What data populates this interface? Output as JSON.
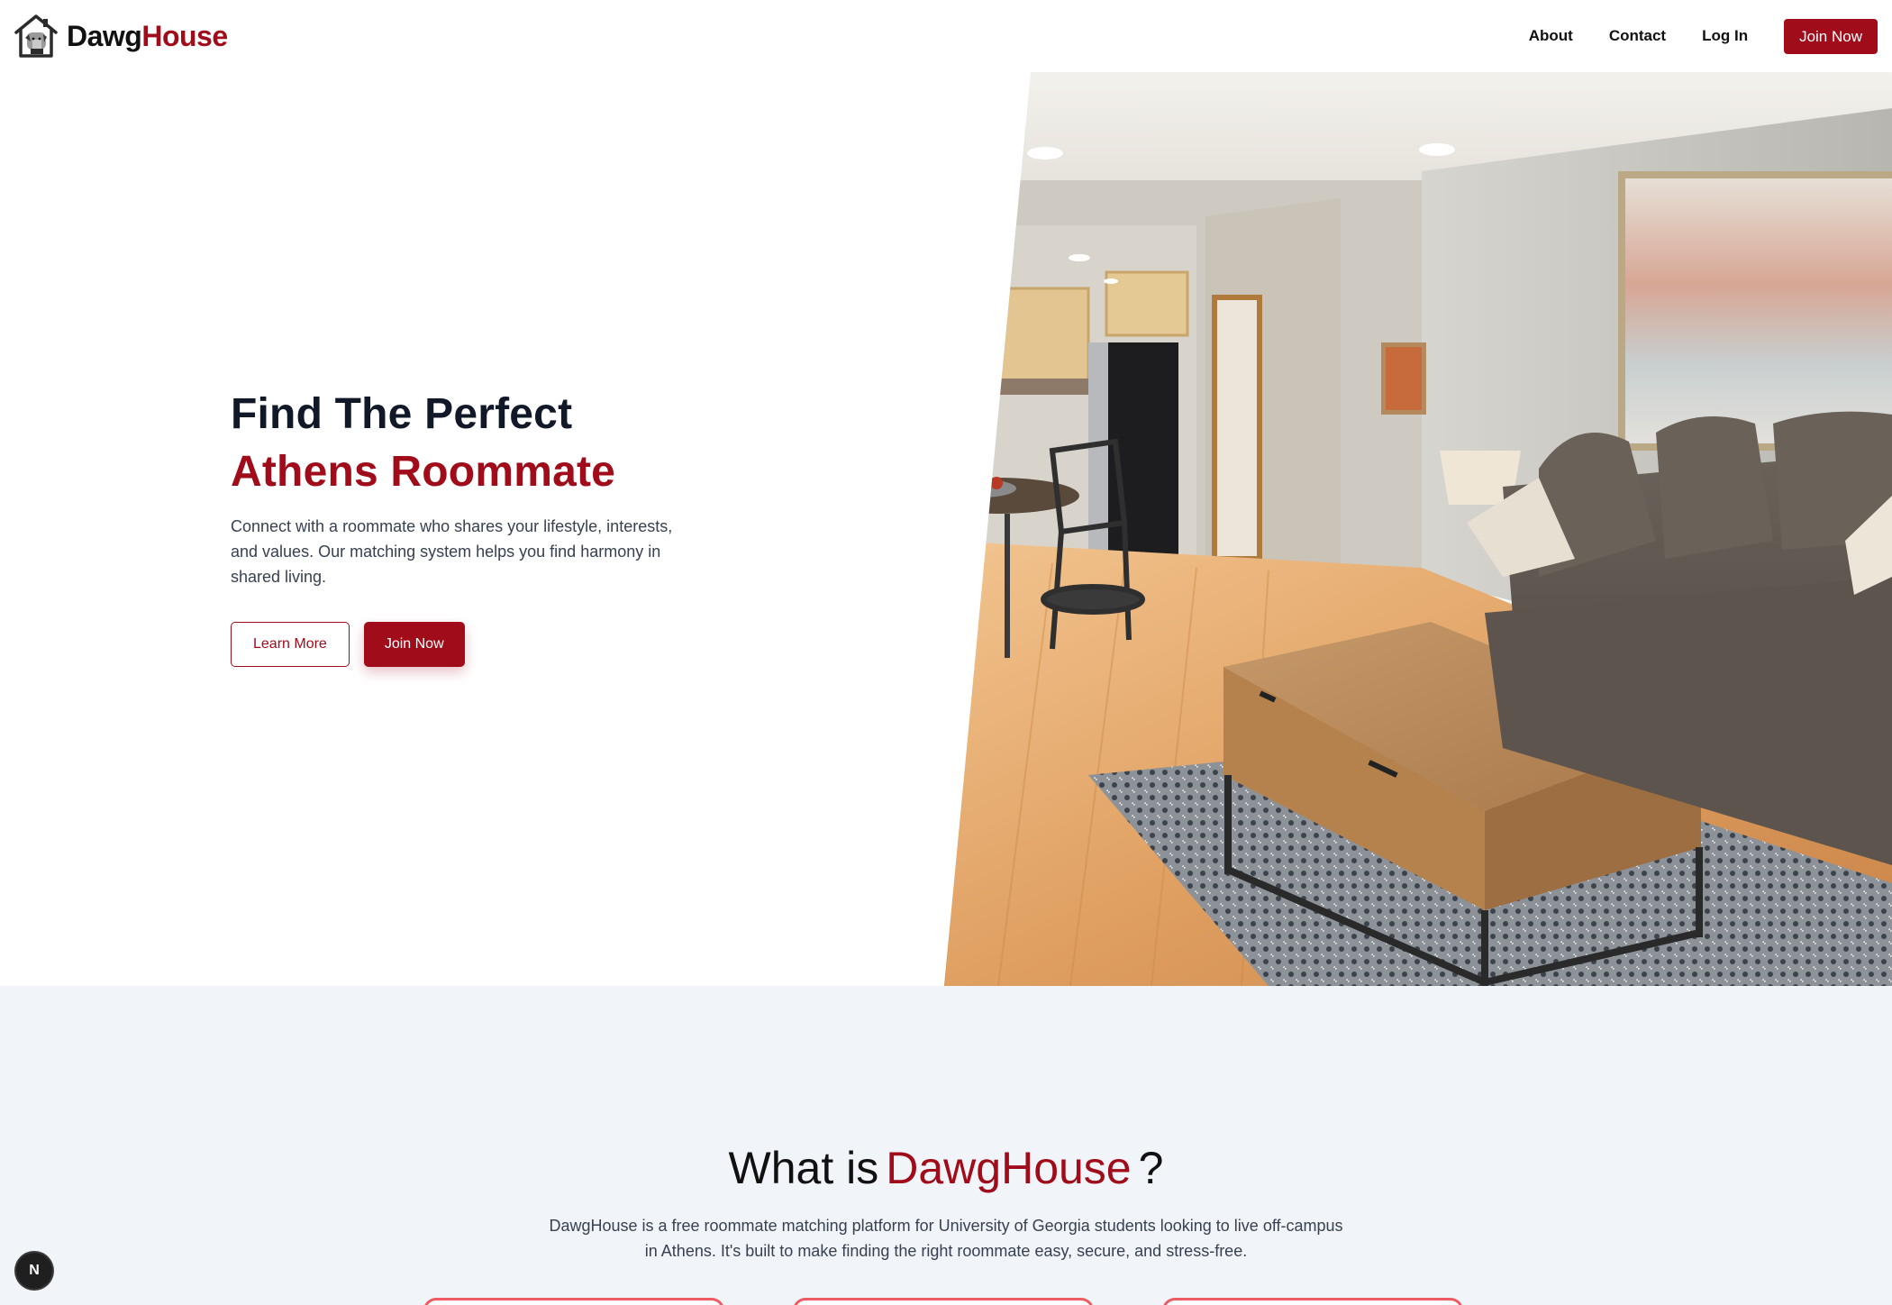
{
  "navbar": {
    "brand": {
      "part1": "Dawg",
      "part2": "House",
      "logo_icon": "house-dog-logo-icon"
    },
    "links": [
      {
        "label": "About"
      },
      {
        "label": "Contact"
      },
      {
        "label": "Log In"
      }
    ],
    "join_label": "Join Now"
  },
  "hero": {
    "title_line1": "Find The Perfect",
    "title_line2": "Athens Roommate",
    "description": "Connect with a roommate who shares your lifestyle, interests, and values. Our matching system helps you find harmony in shared living.",
    "learn_more_label": "Learn More",
    "join_label": "Join Now",
    "image_icon": "living-room-photo"
  },
  "about": {
    "title_prefix": "What is",
    "title_brand": "DawgHouse",
    "title_suffix": "?",
    "description": "DawgHouse is a free roommate matching platform for University of Georgia students looking to live off-campus in Athens. It's built to make finding the right roommate easy, secure, and stress-free."
  },
  "dev_indicator": {
    "label": "N"
  },
  "colors": {
    "brand_red": "#a00c1a",
    "text_dark": "#111827",
    "section_bg": "#f1f4f8",
    "card_border": "#ef5b63"
  }
}
